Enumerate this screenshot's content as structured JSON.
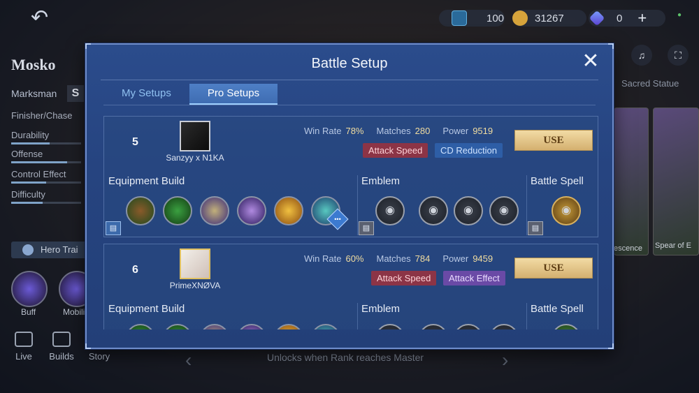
{
  "resources": {
    "tickets": "100",
    "coins": "31267",
    "diamonds": "0"
  },
  "hero": {
    "name": "Mosko",
    "role": "Marksman",
    "role_icon": "S",
    "stats": [
      {
        "label": "Finisher/Chase"
      },
      {
        "label": "Durability",
        "level": 0.55
      },
      {
        "label": "Offense",
        "level": 0.8
      },
      {
        "label": "Control Effect",
        "level": 0.5
      },
      {
        "label": "Difficulty",
        "level": 0.45
      }
    ],
    "hero_train": "Hero Trai",
    "skills": [
      "Buff",
      "Mobili"
    ],
    "nav": [
      "Live",
      "Builds",
      "Story"
    ]
  },
  "background": {
    "sacred": "Sacred Statue",
    "card1": "escence",
    "card2": "Spear of E",
    "unlocks": "Unlocks when Rank reaches Master"
  },
  "modal": {
    "title": "Battle Setup",
    "tabs": [
      {
        "label": "My Setups",
        "active": false
      },
      {
        "label": "Pro Setups",
        "active": true
      }
    ],
    "labels": {
      "win_rate": "Win Rate",
      "matches": "Matches",
      "power": "Power",
      "use": "USE",
      "equipment": "Equipment Build",
      "emblem": "Emblem",
      "spell": "Battle Spell"
    },
    "setups": [
      {
        "rank": "5",
        "player": "Sanzyy x N1KA",
        "win_rate": "78%",
        "matches": "280",
        "power": "9519",
        "tags": [
          "Attack Speed",
          "CD Reduction"
        ]
      },
      {
        "rank": "6",
        "player": "PrimeXNØVA",
        "win_rate": "60%",
        "matches": "784",
        "power": "9459",
        "tags": [
          "Attack Speed",
          "Attack Effect"
        ]
      }
    ]
  },
  "colors": {
    "modal_bg": "#264480",
    "use_button": "#e6c98a",
    "tag_red": "#8c3446",
    "tag_blue": "#2e5ea6",
    "tag_purple": "#6a4aa6"
  }
}
